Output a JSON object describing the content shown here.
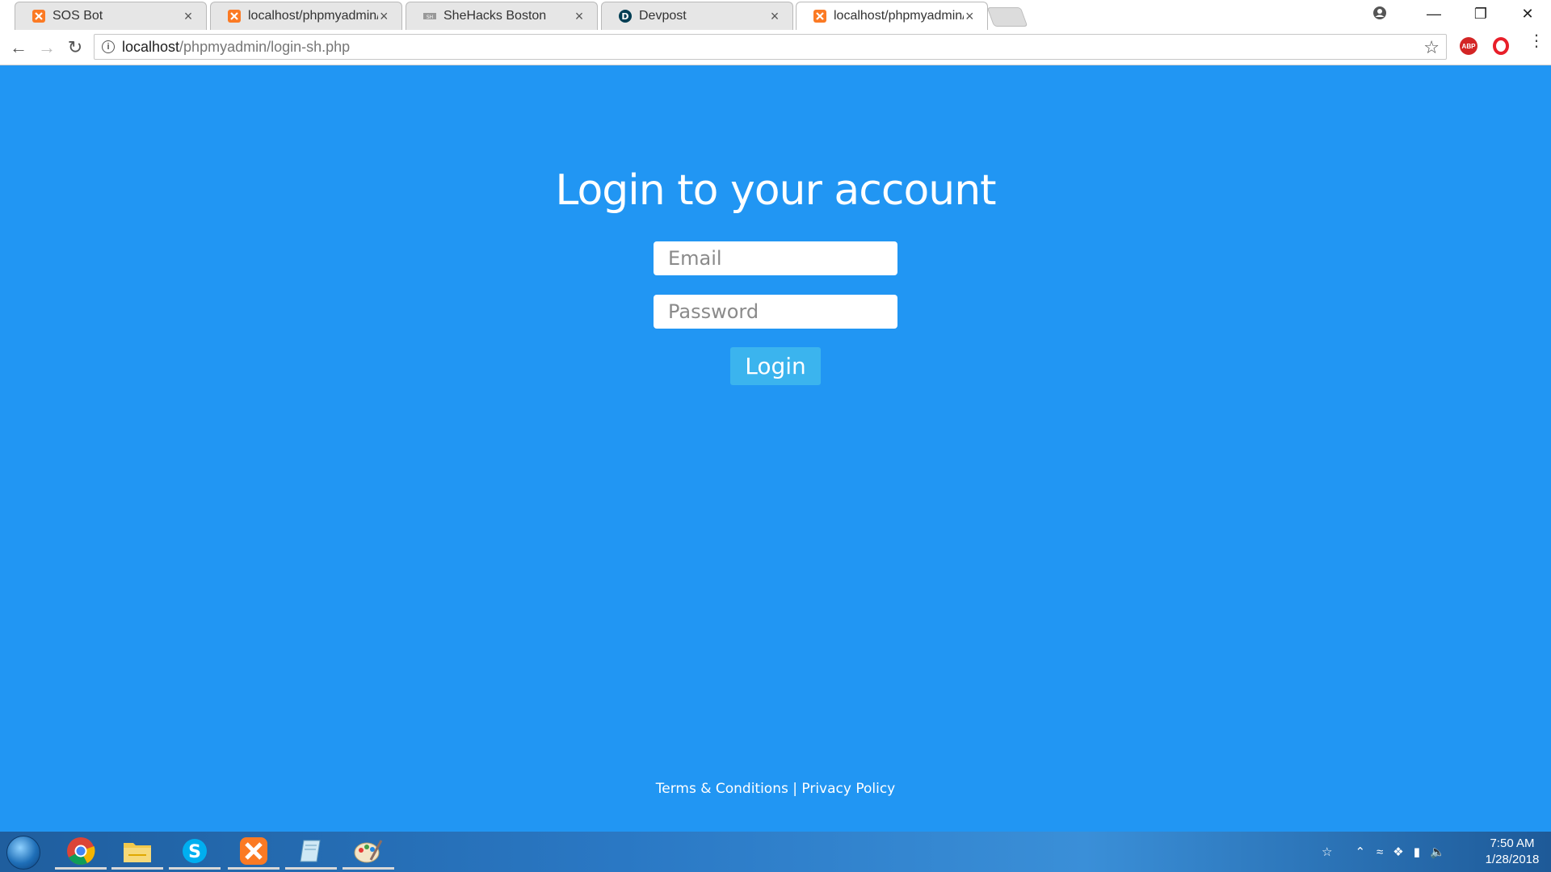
{
  "browser": {
    "tabs": [
      {
        "title": "SOS Bot",
        "icon": "xampp-icon",
        "active": false
      },
      {
        "title": "localhost/phpmyadmin/l",
        "icon": "xampp-icon",
        "active": false
      },
      {
        "title": "SheHacks Boston",
        "icon": "shehacks-icon",
        "active": false
      },
      {
        "title": "Devpost",
        "icon": "devpost-icon",
        "active": false
      },
      {
        "title": "localhost/phpmyadmin/l",
        "icon": "xampp-icon",
        "active": true
      }
    ],
    "address": {
      "host": "localhost",
      "path": "/phpmyadmin/login-sh.php"
    },
    "extensions": [
      "adblock-plus-icon",
      "opera-icon"
    ]
  },
  "page": {
    "title": "Login to your account",
    "email_placeholder": "Email",
    "password_placeholder": "Password",
    "login_label": "Login",
    "footer": {
      "terms": "Terms & Conditions",
      "separator": "|",
      "privacy": "Privacy Policy"
    },
    "background_color": "#2196F3"
  },
  "taskbar": {
    "apps": [
      "chrome-icon",
      "file-explorer-icon",
      "skype-icon",
      "xampp-icon",
      "notepad-icon",
      "paint-icon"
    ],
    "clock": {
      "time": "7:50 AM",
      "date": "1/28/2018"
    }
  }
}
